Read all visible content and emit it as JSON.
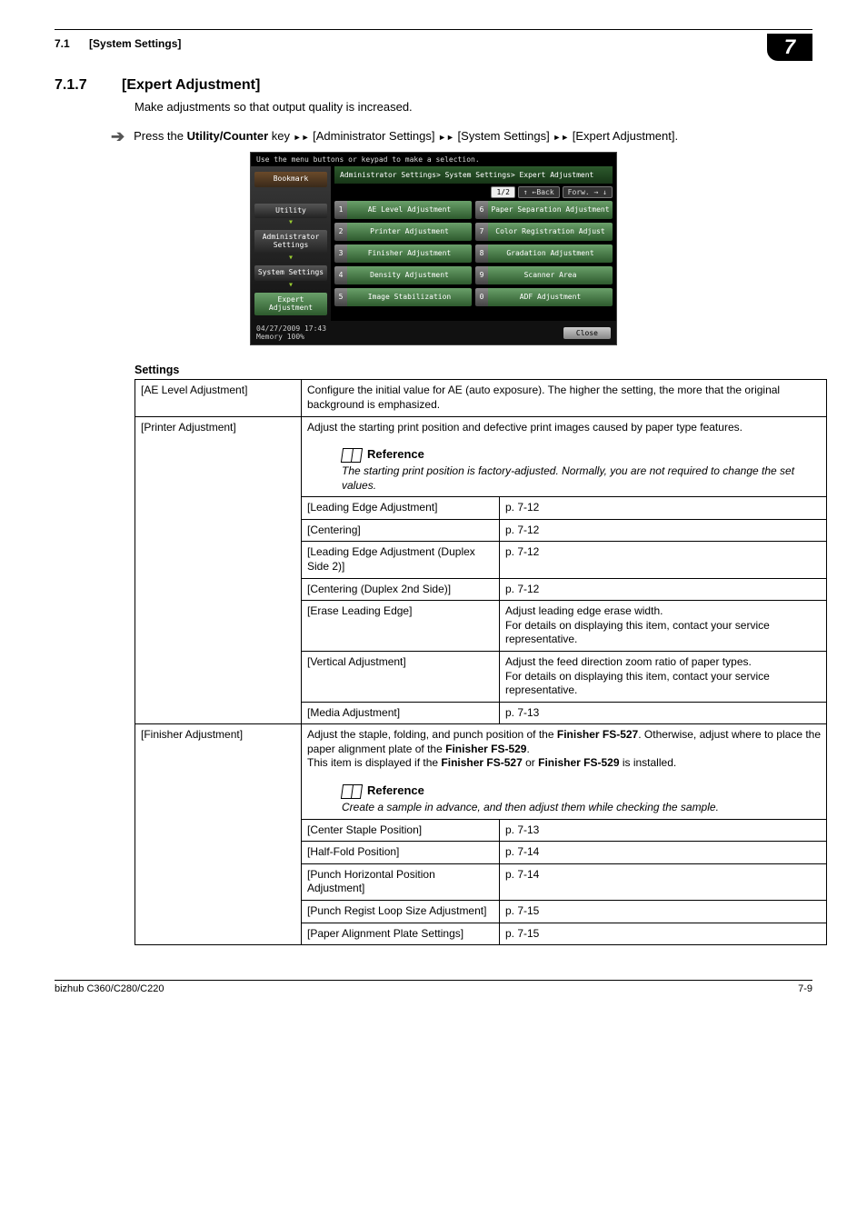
{
  "header": {
    "section_number": "7.1",
    "section_title": "[System Settings]",
    "chapter_number": "7"
  },
  "section": {
    "number": "7.1.7",
    "title": "[Expert Adjustment]",
    "intro": "Make adjustments so that output quality is increased.",
    "nav_instruction_prefix": "Press the ",
    "nav_key": "Utility/Counter",
    "nav_trail_1": " [Administrator Settings] ",
    "nav_trail_2": " [System Settings] ",
    "nav_trail_3": " [Expert Adjustment].",
    "nav_key_suffix": " key "
  },
  "device": {
    "topbar": "Use the menu buttons or keypad to make a selection.",
    "side": {
      "bookmark": "Bookmark",
      "utility": "Utility",
      "admin": "Administrator Settings",
      "system": "System Settings",
      "expert": "Expert Adjustment"
    },
    "breadcrumb": "Administrator Settings> System Settings> Expert Adjustment",
    "pager": {
      "page": "1/2",
      "back": "↑ ←Back",
      "fwd": "Forw. → ↓"
    },
    "left_items": [
      {
        "n": "1",
        "l": "AE Level Adjustment"
      },
      {
        "n": "2",
        "l": "Printer Adjustment"
      },
      {
        "n": "3",
        "l": "Finisher Adjustment"
      },
      {
        "n": "4",
        "l": "Density Adjustment"
      },
      {
        "n": "5",
        "l": "Image Stabilization"
      }
    ],
    "right_items": [
      {
        "n": "6",
        "l": "Paper Separation Adjustment"
      },
      {
        "n": "7",
        "l": "Color Registration Adjust"
      },
      {
        "n": "8",
        "l": "Gradation Adjustment"
      },
      {
        "n": "9",
        "l": "Scanner Area"
      },
      {
        "n": "0",
        "l": "ADF Adjustment"
      }
    ],
    "footer_left1": "04/27/2009   17:43",
    "footer_left2": "Memory      100%",
    "close": "Close"
  },
  "settings_heading": "Settings",
  "tbl": {
    "ae_name": "[AE Level Adjustment]",
    "ae_desc": "Configure the initial value for AE (auto exposure). The higher the setting, the more that the original background is emphasized.",
    "printer_name": "[Printer Adjustment]",
    "printer_desc": "Adjust the starting print position and defective print images caused by paper type features.",
    "ref1_title": "Reference",
    "ref1_body": "The starting print position is factory-adjusted. Normally, you are not required to change the set values.",
    "p_r1_name": "[Leading Edge Adjustment]",
    "p_r1_page": "p. 7-12",
    "p_r2_name": "[Centering]",
    "p_r2_page": "p. 7-12",
    "p_r3_name": "[Leading Edge Adjustment (Duplex Side 2)]",
    "p_r3_page": "p. 7-12",
    "p_r4_name": "[Centering (Duplex 2nd Side)]",
    "p_r4_page": "p. 7-12",
    "p_r5_name": "[Erase Leading Edge]",
    "p_r5_desc": "Adjust leading edge erase width.\nFor details on displaying this item, contact your service representative.",
    "p_r6_name": "[Vertical Adjustment]",
    "p_r6_desc": "Adjust the feed direction zoom ratio of paper types.\nFor details on displaying this item, contact your service representative.",
    "p_r7_name": "[Media Adjustment]",
    "p_r7_page": "p. 7-13",
    "finisher_name": "[Finisher Adjustment]",
    "finisher_desc_1": "Adjust the staple, folding, and punch position of the ",
    "finisher_b1": "Finisher FS-527",
    "finisher_desc_2": ". Otherwise, adjust where to place the paper alignment plate of the ",
    "finisher_b2": "Finisher FS-529",
    "finisher_desc_3": ".",
    "finisher_desc_4": "This item is displayed if the ",
    "finisher_b3": "Finisher FS-527",
    "finisher_desc_5": " or ",
    "finisher_b4": "Finisher FS-529",
    "finisher_desc_6": " is installed.",
    "ref2_title": "Reference",
    "ref2_body": "Create a sample in advance, and then adjust them while checking the sample.",
    "f_r1_name": "[Center Staple Position]",
    "f_r1_page": "p. 7-13",
    "f_r2_name": "[Half-Fold Position]",
    "f_r2_page": "p. 7-14",
    "f_r3_name": "[Punch Horizontal Position Adjustment]",
    "f_r3_page": "p. 7-14",
    "f_r4_name": "[Punch Regist Loop Size Adjustment]",
    "f_r4_page": "p. 7-15",
    "f_r5_name": "[Paper Alignment Plate Settings]",
    "f_r5_page": "p. 7-15"
  },
  "footer": {
    "left": "bizhub C360/C280/C220",
    "right": "7-9"
  }
}
